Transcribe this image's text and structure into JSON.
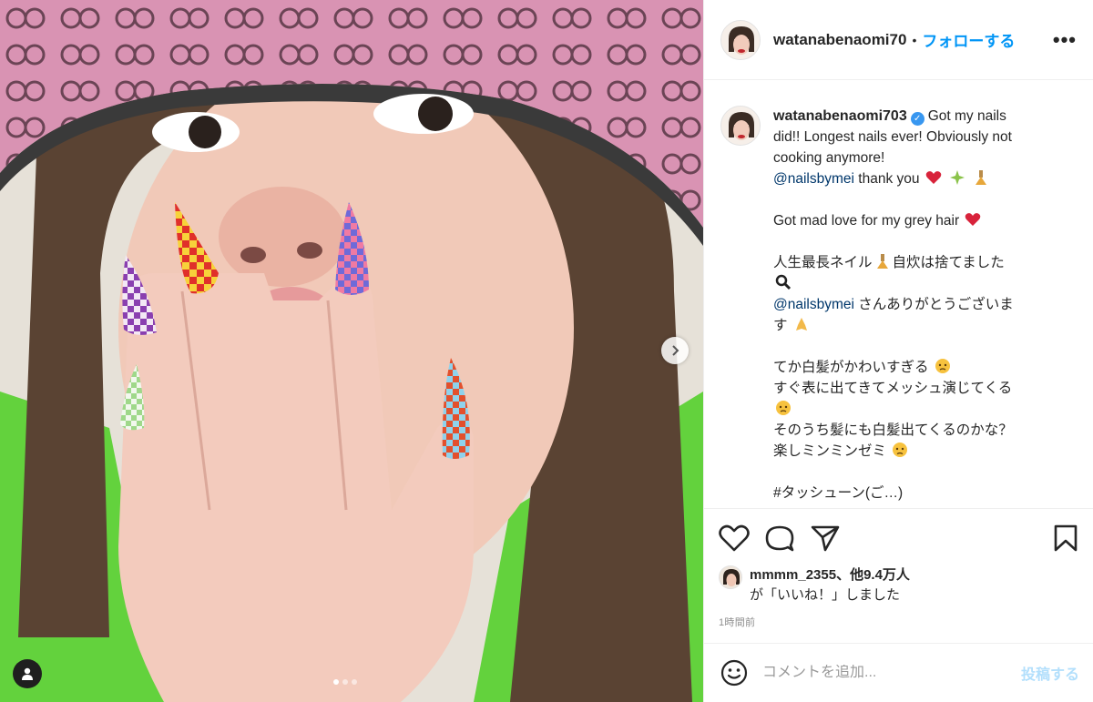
{
  "post": {
    "username": "watanabenaomi703",
    "header_username": "watanabenaomi70",
    "separator": "•",
    "follow_label": "フォローする",
    "more_label": "•••",
    "caption_lines": [
      "Got my nails",
      "did!! Longest nails ever! Obviously not",
      "cooking anymore!"
    ],
    "mention_1": "@nailsbymei",
    "thank_you": " thank you",
    "line_grey_hair": "Got mad love for my grey hair",
    "jp_line_1": "人生最長ネイル",
    "jp_line_1b": "自炊は捨てました",
    "mention_2": "@nailsbymei",
    "jp_line_2": " さんありがとうございま",
    "jp_line_2b": "す",
    "jp_line_3": "てか白髪がかわいすぎる",
    "jp_line_4": "すぐ表に出てきてメッシュ演じてくる",
    "jp_line_5": "そのうち髪にも白髪出てくるのかな？",
    "jp_line_6": "楽しミンミンゼミ",
    "jp_line_7_partial": "#タッシューン(ご…)",
    "liked_by_user": "mmmm_2355",
    "liked_by_rest": "、他9.4万人",
    "liked_suffix": "が「いいね！」しました",
    "timestamp": "1時間前",
    "comment_placeholder": "コメントを追加...",
    "post_label": "投稿する"
  },
  "colors": {
    "accent_blue": "#0095f6",
    "mention_blue": "#00376b",
    "post_disabled": "#b2dffc",
    "verified_blue": "#3897f0"
  },
  "icons": [
    "heart-icon",
    "comment-icon",
    "share-icon",
    "bookmark-icon",
    "more-icon",
    "emoji-icon",
    "next-arrow-icon",
    "user-tag-icon"
  ]
}
